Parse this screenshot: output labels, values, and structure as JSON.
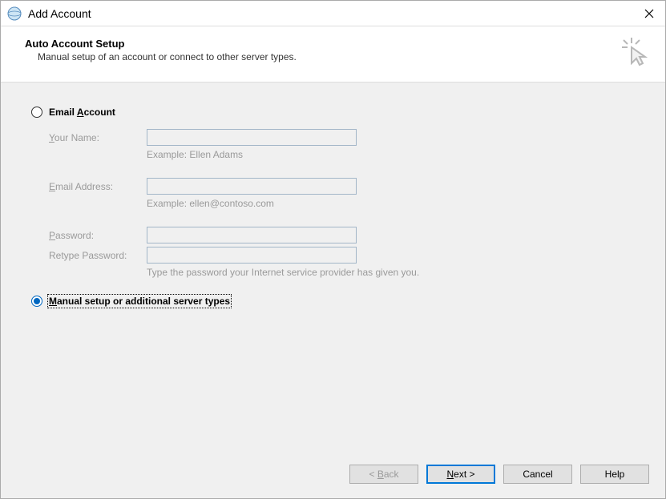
{
  "window": {
    "title": "Add Account"
  },
  "header": {
    "heading": "Auto Account Setup",
    "subheading": "Manual setup of an account or connect to other server types."
  },
  "options": {
    "email_account": {
      "label_prefix": "Email ",
      "label_mn": "A",
      "label_suffix": "ccount",
      "selected": false
    },
    "manual_setup": {
      "label_prefix": "",
      "label_mn": "M",
      "label_suffix": "anual setup or additional server types",
      "selected": true
    }
  },
  "form": {
    "your_name": {
      "label_prefix": "",
      "label_mn": "Y",
      "label_suffix": "our Name:",
      "value": "",
      "hint": "Example: Ellen Adams"
    },
    "email_address": {
      "label_prefix": "",
      "label_mn": "E",
      "label_suffix": "mail Address:",
      "value": "",
      "hint": "Example: ellen@contoso.com"
    },
    "password": {
      "label_prefix": "",
      "label_mn": "P",
      "label_suffix": "assword:",
      "value": ""
    },
    "retype_password": {
      "label": "Retype Password:",
      "value": ""
    },
    "password_hint": "Type the password your Internet service provider has given you."
  },
  "footer": {
    "back": {
      "prefix": "< ",
      "mn": "B",
      "suffix": "ack"
    },
    "next": {
      "prefix": "",
      "mn": "N",
      "suffix": "ext >"
    },
    "cancel": "Cancel",
    "help": "Help"
  }
}
